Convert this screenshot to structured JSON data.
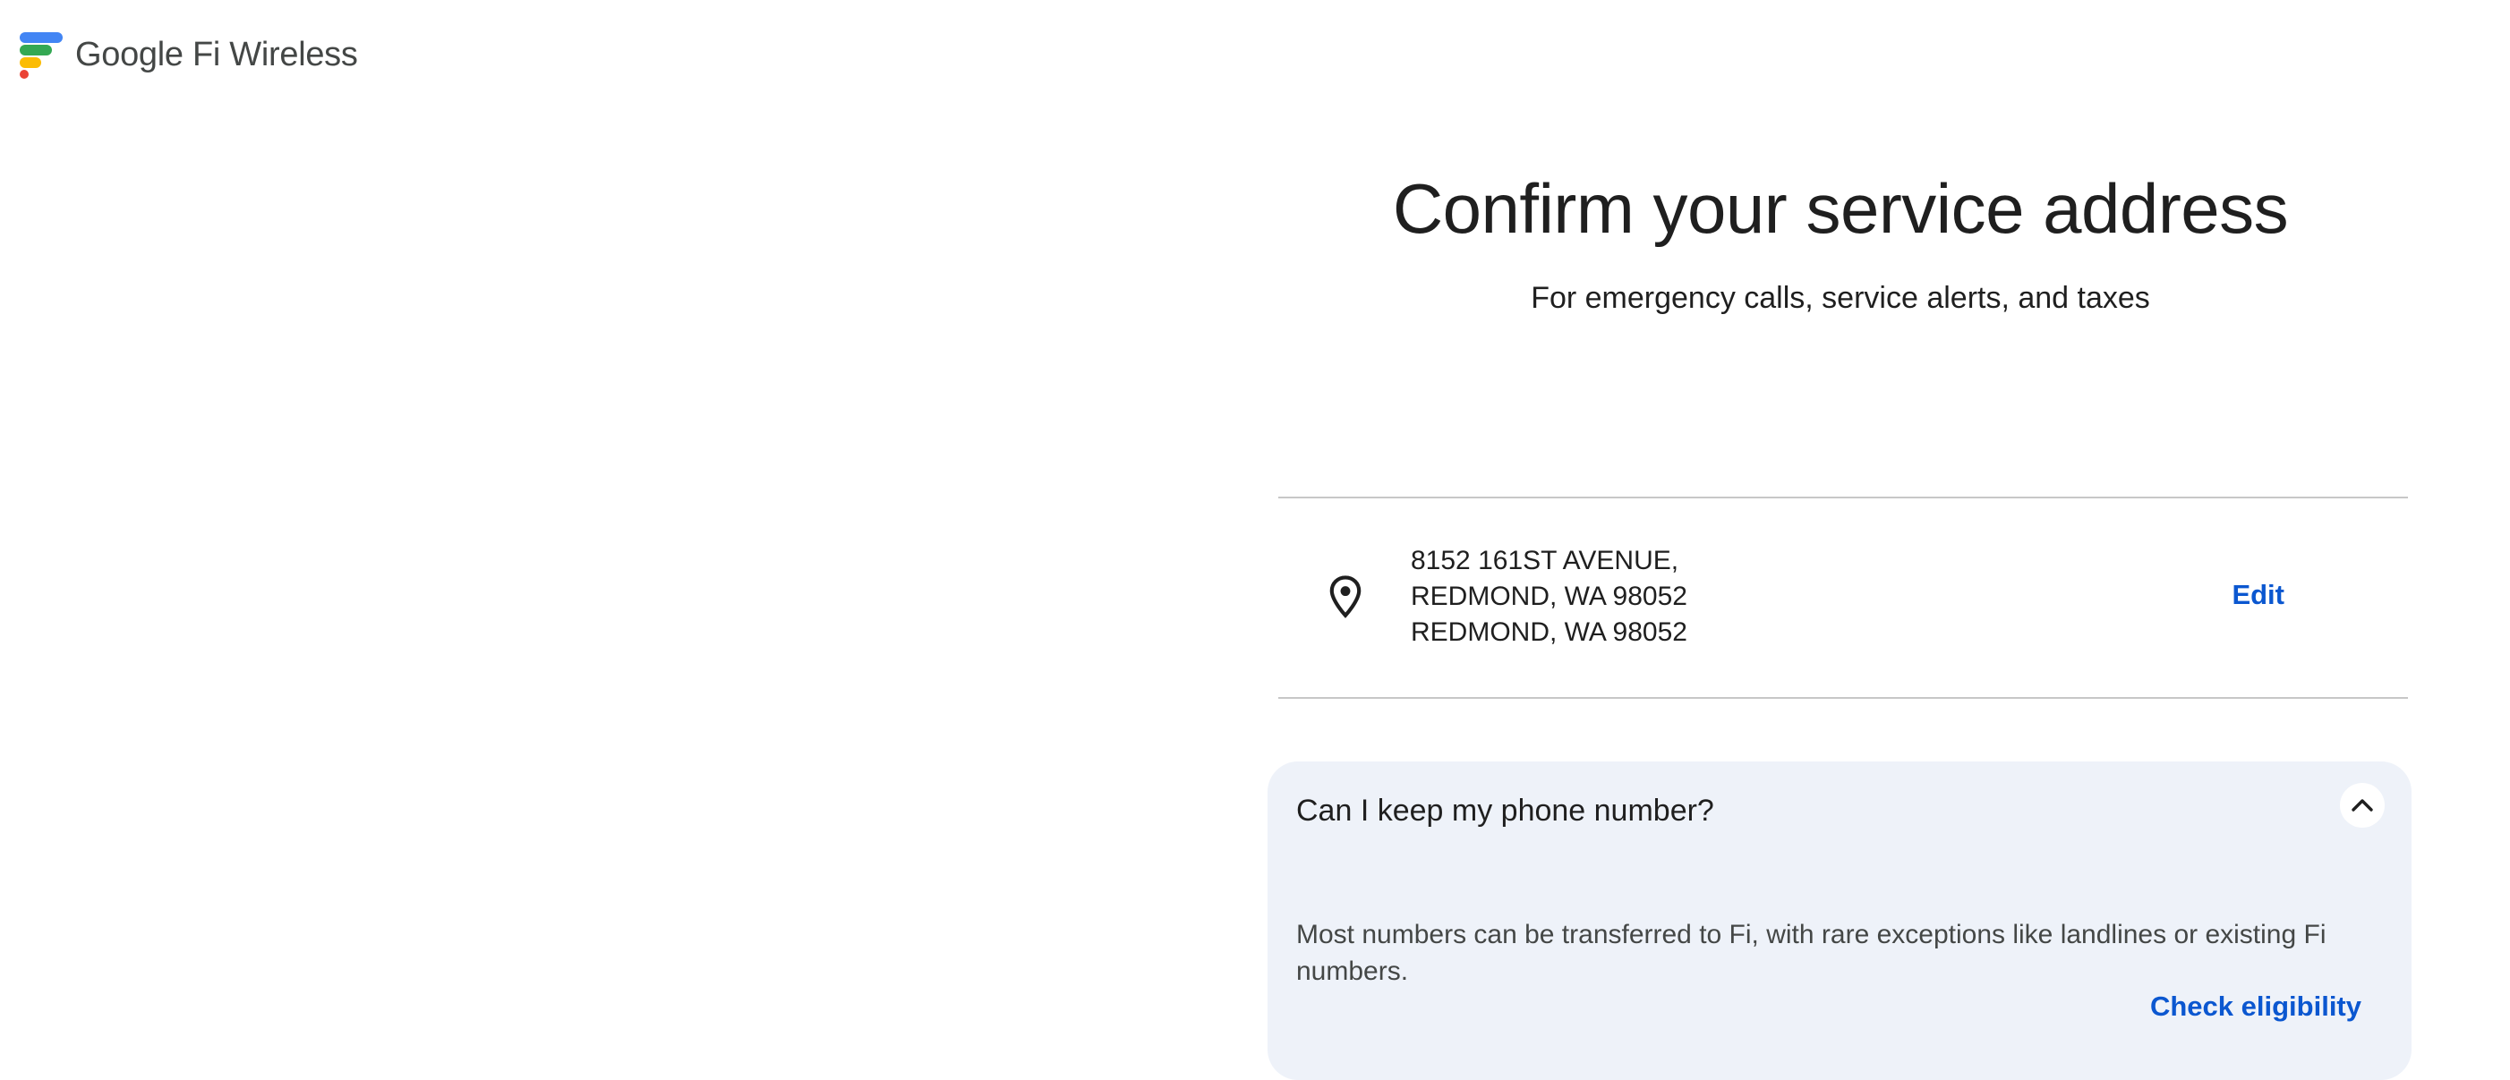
{
  "header": {
    "logo_text": "Google Fi Wireless",
    "logo_colors": [
      "#4285f4",
      "#34a853",
      "#fbbc04",
      "#ea4335"
    ]
  },
  "main": {
    "title": "Confirm your service address",
    "subtitle": "For emergency calls, service alerts, and taxes"
  },
  "address": {
    "icon": "location-pin-icon",
    "lines": [
      "8152 161ST AVENUE,",
      "REDMOND, WA 98052",
      "REDMOND, WA 98052"
    ],
    "edit_label": "Edit"
  },
  "faq": {
    "question": "Can I keep my phone number?",
    "toggle_icon": "chevron-up-icon",
    "answer": "Most numbers can be transferred to Fi, with rare exceptions like landlines or existing Fi numbers.",
    "link_label": "Check eligibility"
  },
  "colors": {
    "accent": "#0b57d0",
    "card_background": "#eef2f9",
    "divider": "#c7c7c7"
  }
}
